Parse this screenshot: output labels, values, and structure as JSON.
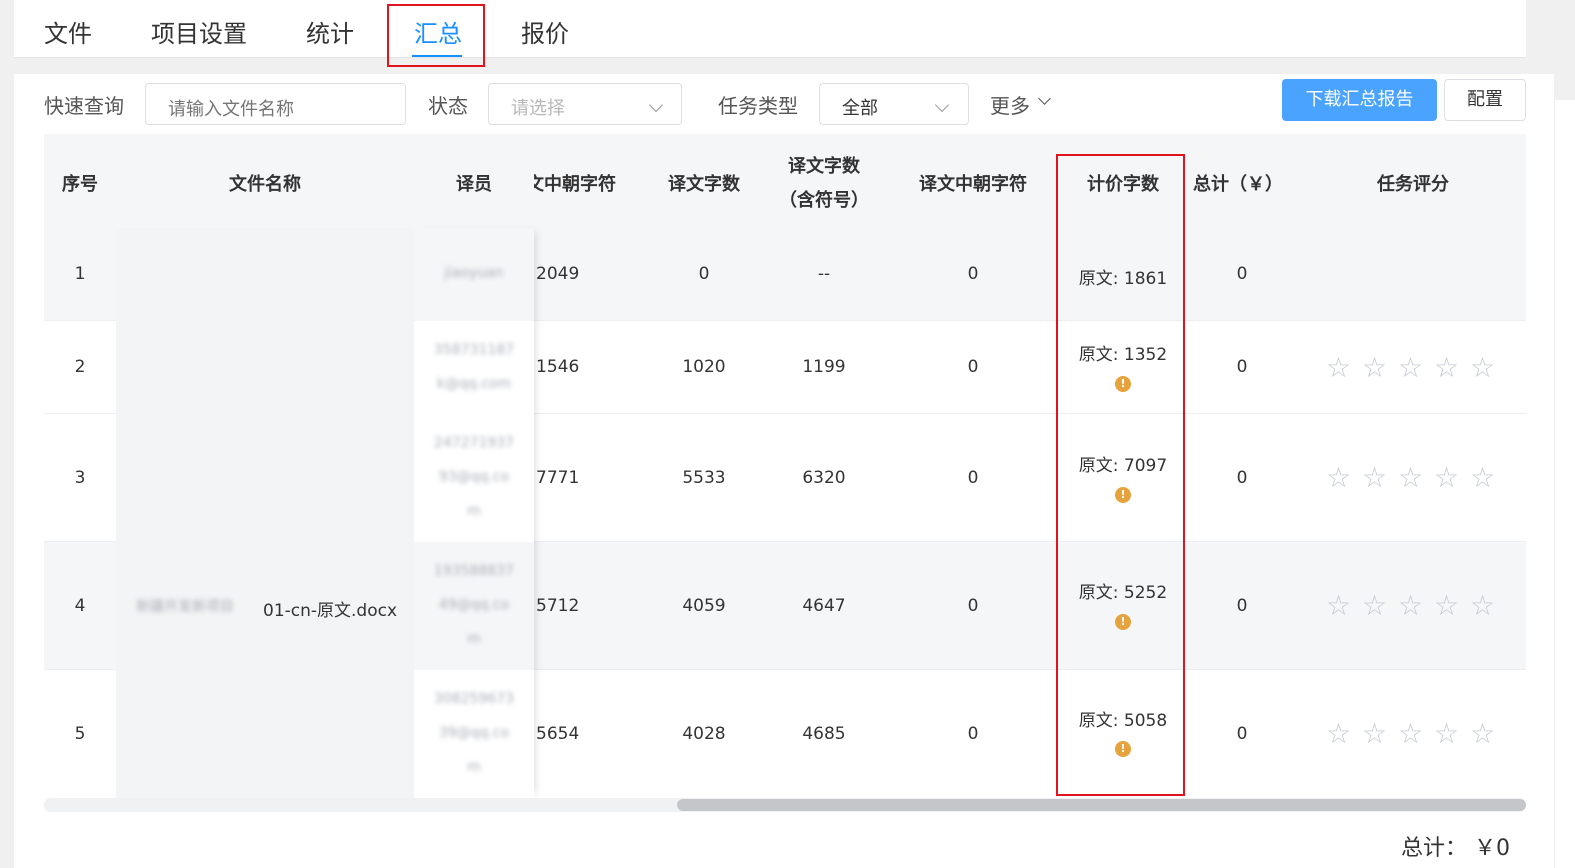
{
  "tabs": [
    {
      "label": "文件"
    },
    {
      "label": "项目设置"
    },
    {
      "label": "统计"
    },
    {
      "label": "汇总"
    },
    {
      "label": "报价"
    }
  ],
  "active_tab": "汇总",
  "filters": {
    "quick_search_label": "快速查询",
    "quick_search_placeholder": "请输入文件名称",
    "status_label": "状态",
    "status_placeholder": "请选择",
    "task_type_label": "任务类型",
    "task_type_value": "全部",
    "more_label": "更多"
  },
  "actions": {
    "download_label": "下载汇总报告",
    "config_label": "配置"
  },
  "table": {
    "headers": {
      "index": "序号",
      "file_name": "文件名称",
      "translator": "译员",
      "src_cjk_partial": "文中朝字符",
      "target_words": "译文字数",
      "target_words_incl_1": "译文字数",
      "target_words_incl_2": "（含符号）",
      "target_cjk": "译文中朝字符",
      "billing_words": "计价字数",
      "total": "总计（￥）",
      "rating": "任务评分"
    },
    "file_name_visible": "01-cn-原文.docx",
    "file_name_blurred": "新疆开发新项目",
    "rows": [
      {
        "index": "1",
        "translator_blur": [
          "jiaoyuan"
        ],
        "src_cjk": "2049",
        "target_words": "0",
        "target_words_incl": "--",
        "target_cjk": "0",
        "billing": "原文: 1861",
        "warn": false,
        "total": "0",
        "stars": false
      },
      {
        "index": "2",
        "translator_blur": [
          "358731187",
          "k@qq.com"
        ],
        "src_cjk": "1546",
        "target_words": "1020",
        "target_words_incl": "1199",
        "target_cjk": "0",
        "billing": "原文: 1352",
        "warn": true,
        "total": "0",
        "stars": true
      },
      {
        "index": "3",
        "translator_blur": [
          "247271937",
          "93@qq.co",
          "m"
        ],
        "src_cjk": "7771",
        "target_words": "5533",
        "target_words_incl": "6320",
        "target_cjk": "0",
        "billing": "原文: 7097",
        "warn": true,
        "total": "0",
        "stars": true
      },
      {
        "index": "4",
        "translator_blur": [
          "193588837",
          "49@qq.co",
          "m"
        ],
        "src_cjk": "5712",
        "target_words": "4059",
        "target_words_incl": "4647",
        "target_cjk": "0",
        "billing": "原文: 5252",
        "warn": true,
        "total": "0",
        "stars": true
      },
      {
        "index": "5",
        "translator_blur": [
          "308259673",
          "39@qq.co",
          "m"
        ],
        "src_cjk": "5654",
        "target_words": "4028",
        "target_words_incl": "4685",
        "target_cjk": "0",
        "billing": "原文: 5058",
        "warn": true,
        "total": "0",
        "stars": true
      }
    ]
  },
  "footer": {
    "total_text": "总计： ￥0"
  },
  "icons": {
    "warn": "warning-circle-icon",
    "star": "star-outline-icon",
    "chevron": "chevron-down-icon"
  },
  "colors": {
    "accent": "#1890ff",
    "primary_button": "#4aa3ff",
    "highlight": "#e0141e",
    "warning": "#e6a23c"
  }
}
